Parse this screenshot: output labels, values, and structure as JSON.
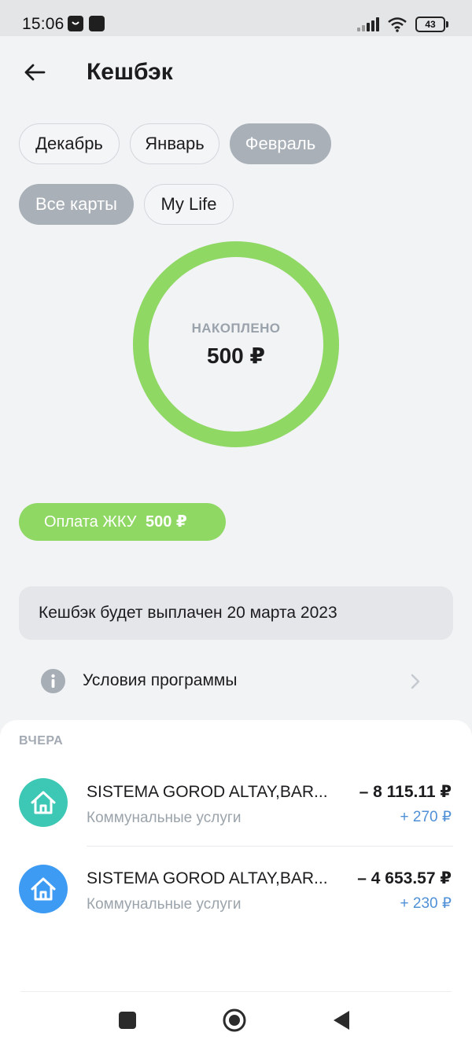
{
  "status_bar": {
    "time": "15:06",
    "battery": "43"
  },
  "header": {
    "title": "Кешбэк"
  },
  "months": [
    {
      "label": "Декабрь",
      "selected": false
    },
    {
      "label": "Январь",
      "selected": false
    },
    {
      "label": "Февраль",
      "selected": true
    }
  ],
  "cards": [
    {
      "label": "Все карты",
      "selected": true
    },
    {
      "label": "My Life",
      "selected": false
    }
  ],
  "summary": {
    "label": "НАКОПЛЕНО",
    "amount": "500 ₽",
    "ring_fill": 1.0,
    "ring_color": "#8fd863"
  },
  "category": {
    "name": "Оплата ЖКУ",
    "amount": "500 ₽",
    "color": "#8fd863"
  },
  "notice": {
    "text": "Кешбэк будет выплачен 20 марта 2023"
  },
  "conditions": {
    "label": "Условия программы"
  },
  "history": {
    "section": "ВЧЕРА",
    "transactions": [
      {
        "merchant": "SISTEMA GOROD ALTAY,BAR...",
        "category": "Коммунальные услуги",
        "amount": "– 8 115.11 ₽",
        "cashback": "+ 270 ₽",
        "icon": "house-icon",
        "color": "#3cc8b4"
      },
      {
        "merchant": "SISTEMA GOROD ALTAY,BAR...",
        "category": "Коммунальные услуги",
        "amount": "– 4 653.57 ₽",
        "cashback": "+ 230 ₽",
        "icon": "house-icon",
        "color": "#3e9bf3"
      }
    ]
  },
  "colors": {
    "accent_green": "#8fd863",
    "cashback_blue": "#4f90d6",
    "chip_selected": "#a9b0b8"
  }
}
